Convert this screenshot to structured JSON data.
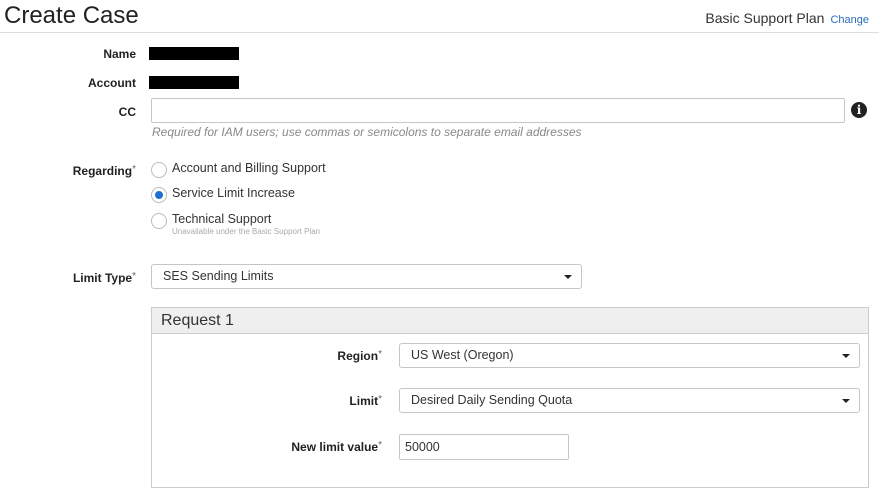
{
  "header": {
    "title": "Create Case",
    "plan_label": "Basic Support Plan",
    "change_link": "Change"
  },
  "form": {
    "name_label": "Name",
    "account_label": "Account",
    "cc_label": "CC",
    "cc_value": "",
    "cc_hint": "Required for IAM users; use commas or semicolons to separate email addresses",
    "regarding_label": "Regarding",
    "required_mark": "*",
    "regarding_options": [
      {
        "label": "Account and Billing Support",
        "checked": false,
        "sub": ""
      },
      {
        "label": "Service Limit Increase",
        "checked": true,
        "sub": ""
      },
      {
        "label": "Technical Support",
        "checked": false,
        "sub": "Unavailable under the Basic Support Plan"
      }
    ],
    "limit_type_label": "Limit Type",
    "limit_type_value": "SES Sending Limits"
  },
  "request": {
    "title": "Request 1",
    "region_label": "Region",
    "region_value": "US West (Oregon)",
    "limit_label": "Limit",
    "limit_value": "Desired Daily Sending Quota",
    "new_limit_label": "New limit value",
    "new_limit_value": "50000"
  },
  "colors": {
    "link": "#2a6ebb",
    "radio_selected": "#1f6fcf",
    "panel_header": "#efefef"
  }
}
